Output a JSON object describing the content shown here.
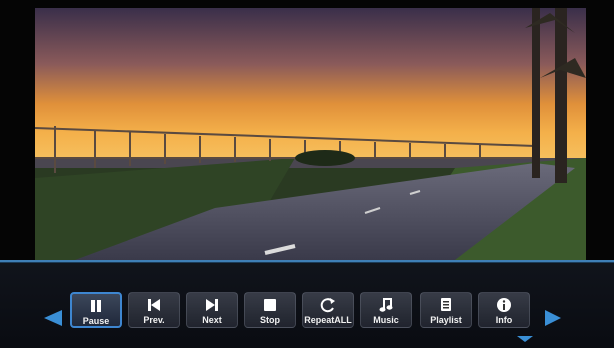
{
  "controls": [
    {
      "label": "Pause",
      "icon": "pause-icon",
      "active": true
    },
    {
      "label": "Prev.",
      "icon": "previous-icon",
      "active": false
    },
    {
      "label": "Next",
      "icon": "next-icon",
      "active": false
    },
    {
      "label": "Stop",
      "icon": "stop-icon",
      "active": false
    },
    {
      "label": "RepeatALL",
      "icon": "repeat-icon",
      "active": false
    },
    {
      "label": "Music",
      "icon": "music-note-icon",
      "active": false
    },
    {
      "label": "Playlist",
      "icon": "playlist-icon",
      "active": false
    },
    {
      "label": "Info",
      "icon": "info-icon",
      "active": false
    }
  ],
  "colors": {
    "accent": "#3a8fd6",
    "bar_line": "#3f7fb6"
  }
}
